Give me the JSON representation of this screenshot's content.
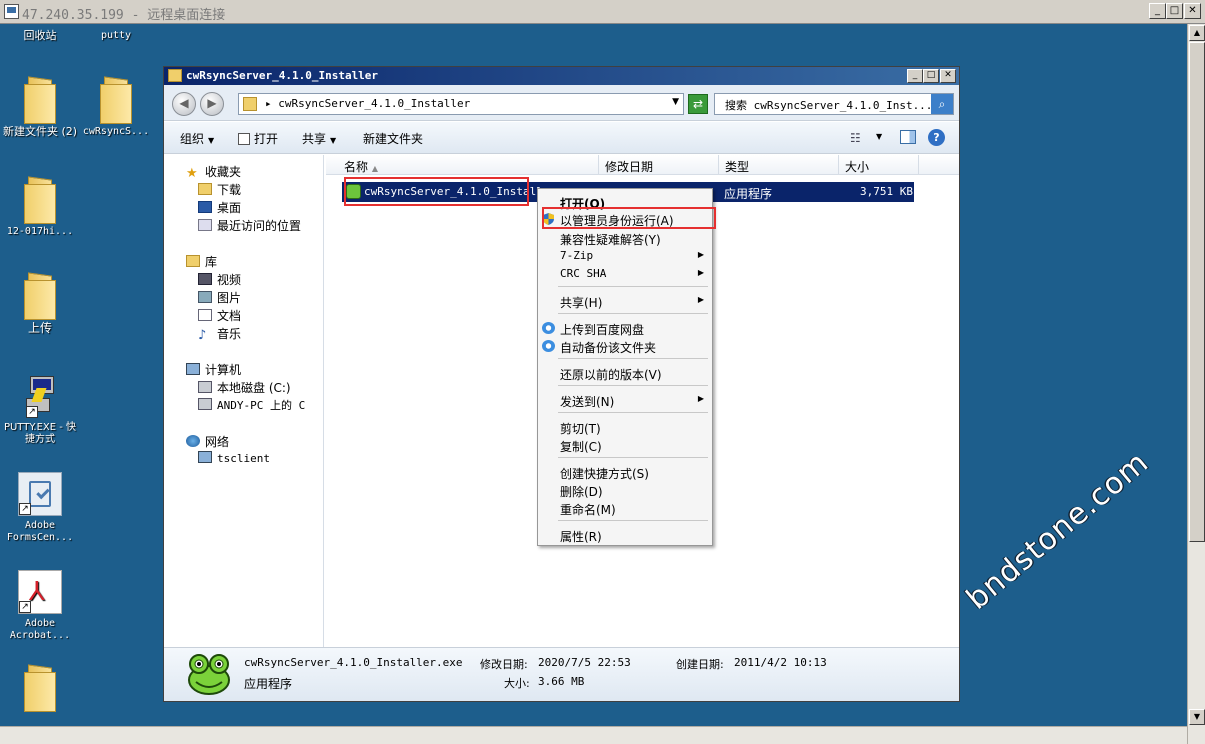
{
  "remote_desktop": {
    "title": "47.240.35.199 - 远程桌面连接",
    "buttons": {
      "minimize": "_",
      "restore": "□",
      "close": "✕"
    }
  },
  "desktop": {
    "icons": [
      {
        "label": "回收站"
      },
      {
        "label": "putty"
      },
      {
        "label": "新建文件夹 (2)"
      },
      {
        "label": "cwRsyncS..."
      },
      {
        "label": "12-017hi..."
      },
      {
        "label": "上传"
      },
      {
        "label": "PUTTY.EXE - 快捷方式"
      },
      {
        "label": "Adobe FormsCen..."
      },
      {
        "label": "Adobe Acrobat..."
      }
    ]
  },
  "explorer": {
    "title": "cwRsyncServer_4.1.0_Installer",
    "address": "▸ cwRsyncServer_4.1.0_Installer",
    "search_text": "搜索 cwRsyncServer_4.1.0_Inst...",
    "toolbar": {
      "organize": "组织",
      "open": "打开",
      "share": "共享",
      "new_folder": "新建文件夹"
    },
    "nav": {
      "favorites": "收藏夹",
      "downloads": "下载",
      "desktop": "桌面",
      "recent": "最近访问的位置",
      "libraries": "库",
      "videos": "视频",
      "pictures": "图片",
      "documents": "文档",
      "music": "音乐",
      "computer": "计算机",
      "local_disk": "本地磁盘 (C:)",
      "andy_pc": "ANDY-PC 上的 C",
      "network": "网络",
      "tsclient": "tsclient"
    },
    "columns": {
      "name": "名称",
      "modified": "修改日期",
      "type": "类型",
      "size": "大小"
    },
    "file": {
      "name": "cwRsyncServer_4.1.0_Installer",
      "type": "应用程序",
      "size": "3,751 KB"
    },
    "status": {
      "filename": "cwRsyncServer_4.1.0_Installer.exe",
      "modified_label": "修改日期:",
      "modified_value": "2020/7/5 22:53",
      "created_label": "创建日期:",
      "created_value": "2011/4/2 10:13",
      "kind": "应用程序",
      "size_label": "大小:",
      "size_value": "3.66 MB"
    }
  },
  "context_menu": {
    "open": "打开(O)",
    "run_as_admin": "以管理员身份运行(A)",
    "troubleshoot": "兼容性疑难解答(Y)",
    "sevenzip": "7-Zip",
    "crc_sha": "CRC SHA",
    "share": "共享(H)",
    "upload_baidu": "上传到百度网盘",
    "auto_backup": "自动备份该文件夹",
    "restore_prev": "还原以前的版本(V)",
    "send_to": "发送到(N)",
    "cut": "剪切(T)",
    "copy": "复制(C)",
    "create_shortcut": "创建快捷方式(S)",
    "delete": "删除(D)",
    "rename": "重命名(M)",
    "properties": "属性(R)"
  },
  "watermark": "bndstone.com"
}
